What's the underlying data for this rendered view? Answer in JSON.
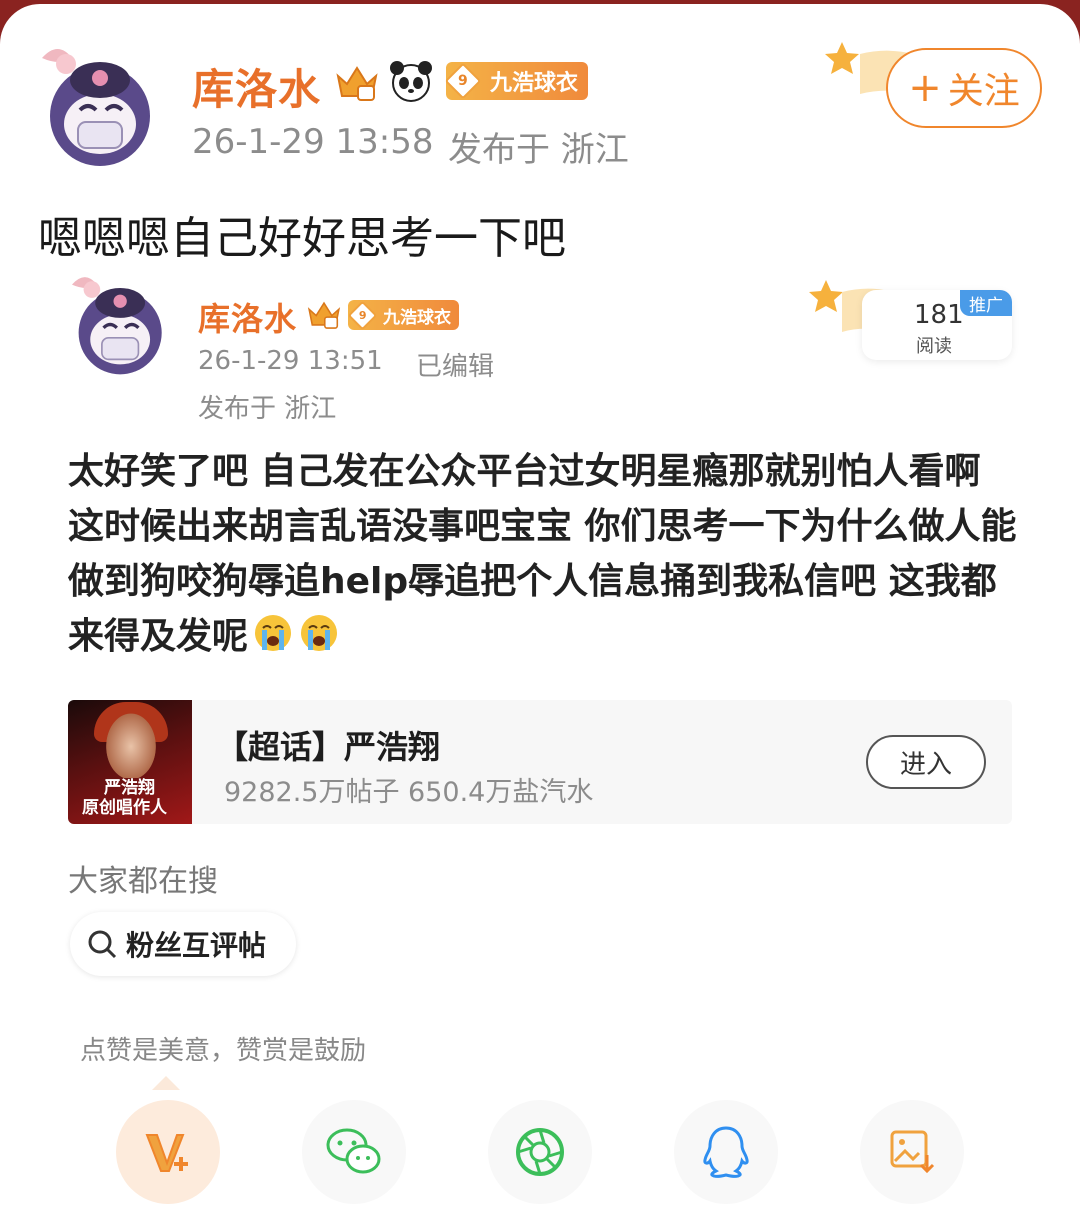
{
  "header": {
    "username": "库洛水",
    "level_number": "9",
    "level_label": "九浩球衣",
    "time": "26-1-29 13:58",
    "location": "发布于 浙江",
    "follow_label": "关注"
  },
  "repost_text": "嗯嗯嗯自己好好思考一下吧",
  "original": {
    "username": "库洛水",
    "level_number": "9",
    "level_label": "九浩球衣",
    "time": "26-1-29 13:51",
    "edited": "已编辑",
    "location": "发布于 浙江",
    "read_count": "181",
    "read_label": "阅读",
    "promo_tag": "推广",
    "body": "太好笑了吧 自己发在公众平台过女明星瘾那就别怕人看啊 这时候出来胡言乱语没事吧宝宝 你们思考一下为什么做人能做到狗咬狗辱追help辱追把个人信息捅到我私信吧 这我都来得及发呢"
  },
  "topic_card": {
    "title": "【超话】严浩翔",
    "stats": "9282.5万帖子 650.4万盐汽水",
    "enter_label": "进入",
    "image_caption_line1": "严浩翔",
    "image_caption_line2": "原创唱作人"
  },
  "search": {
    "header": "大家都在搜",
    "chip_label": "粉丝互评帖"
  },
  "reward_hint": "点赞是美意，赞赏是鼓励",
  "actions": [
    "reward-icon",
    "wechat-icon",
    "moments-icon",
    "qq-icon",
    "save-image-icon"
  ],
  "colors": {
    "brand_orange": "#f0862c",
    "username_orange": "#e8702a",
    "promo_blue": "#4a9be8",
    "muted_gray": "#8c8c8c"
  }
}
